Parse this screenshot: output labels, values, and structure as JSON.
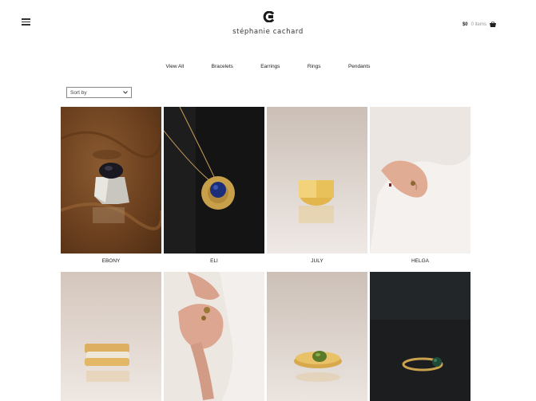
{
  "header": {
    "brand": "stéphanie cachard",
    "cart_price": "$0",
    "cart_count": "0 items"
  },
  "nav": [
    "View All",
    "Bracelets",
    "Earrings",
    "Rings",
    "Pendants"
  ],
  "sort": {
    "label": "Sort by"
  },
  "products": [
    {
      "name": "EBONY",
      "photo": "ring-black-stone-wood"
    },
    {
      "name": "ELI",
      "photo": "pendant-blue-stone-dark"
    },
    {
      "name": "JULY",
      "photo": "gold-band-ring"
    },
    {
      "name": "HELGA",
      "photo": "hand-wearing-ring"
    },
    {
      "name": "",
      "photo": "stacked-gold-rings"
    },
    {
      "name": "",
      "photo": "hands-wearing-rings"
    },
    {
      "name": "",
      "photo": "gold-ring-green-stone"
    },
    {
      "name": "",
      "photo": "gold-ring-dark-bg"
    }
  ],
  "colors": {
    "text": "#222222",
    "muted": "#999999"
  }
}
